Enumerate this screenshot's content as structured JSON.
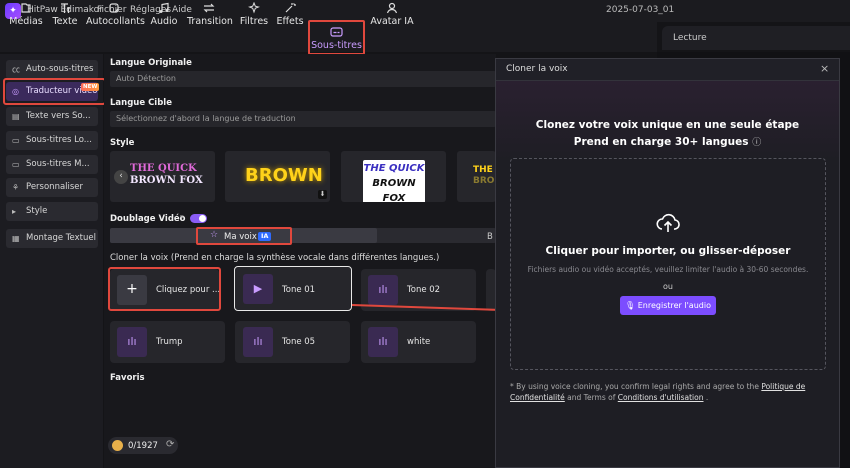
{
  "app": {
    "name": "HitPaw Edimakor",
    "menu": [
      "Fichier",
      "Réglages",
      "Aide"
    ],
    "project_title": "2025-07-03_01"
  },
  "toolbar": {
    "items": [
      {
        "label": "Médias",
        "icon": "media-icon"
      },
      {
        "label": "Texte",
        "icon": "text-icon"
      },
      {
        "label": "Autocollants",
        "icon": "sticker-icon"
      },
      {
        "label": "Audio",
        "icon": "music-icon"
      },
      {
        "label": "Transition",
        "icon": "transition-icon"
      },
      {
        "label": "Filtres",
        "icon": "filter-icon"
      },
      {
        "label": "Effets",
        "icon": "effects-icon"
      },
      {
        "label": "Sous-titres",
        "icon": "subtitles-icon"
      },
      {
        "label": "Avatar IA",
        "icon": "avatar-icon"
      }
    ],
    "active": "Sous-titres"
  },
  "preview": {
    "tab_label": "Lecture"
  },
  "sidebar": {
    "items": [
      {
        "label": "Auto-sous-titres",
        "icon": "cc-icon"
      },
      {
        "label": "Traducteur vidéo",
        "icon": "translate-icon",
        "badge": "NEW"
      },
      {
        "label": "Texte vers So...",
        "icon": "text-to-speech-icon"
      },
      {
        "label": "Sous-titres Lo...",
        "icon": "subtitle-local-icon"
      },
      {
        "label": "Sous-titres M...",
        "icon": "subtitle-multi-icon"
      },
      {
        "label": "Personnaliser",
        "icon": "customize-icon"
      },
      {
        "label": "Style",
        "icon": "caret-right-icon"
      },
      {
        "label": "Montage Textuel",
        "icon": "text-edit-icon"
      }
    ],
    "active": "Traducteur vidéo"
  },
  "main": {
    "langue_originale": {
      "label": "Langue Originale",
      "value": "Auto Détection"
    },
    "langue_cible": {
      "label": "Langue Cible",
      "placeholder": "Sélectionnez d'abord la langue de traduction"
    },
    "style": {
      "label": "Style",
      "cards": [
        {
          "line1": "THE QUICK",
          "line2": "BROWN FOX"
        },
        {
          "line1": "BROWN",
          "line2": ""
        },
        {
          "line1": "THE QUICK",
          "line2": "BROWN FOX"
        },
        {
          "line1": "THE",
          "line2": "BRO"
        }
      ]
    },
    "doublage": {
      "label": "Doublage Vidéo",
      "enabled": true,
      "tab_active": "Ma voix",
      "tab_badge": "IA",
      "tab_other": "B"
    },
    "cloner": {
      "label": "Cloner la voix (Prend en charge la synthèse vocale dans différentes langues.)",
      "add_label": "Cliquez pour ...",
      "voices": [
        "Tone 01",
        "Tone 02",
        "Trump",
        "Tone 05",
        "white"
      ]
    },
    "favoris_label": "Favoris",
    "credits": "0/1927"
  },
  "dialog": {
    "title": "Cloner la voix",
    "heading": "Clonez votre voix unique en une seule étape",
    "subheading": "Prend en charge 30+ langues",
    "upload_title": "Cliquer pour importer, ou glisser-déposer",
    "upload_hint": "Fichiers audio ou vidéo acceptés, veuillez limiter l'audio à 30-60 secondes.",
    "or_label": "ou",
    "record_button": "Enregistrer l'audio",
    "disclaimer_1": "* By using voice cloning, you confirm legal rights and agree to the",
    "disclaimer_link1": "Politique de Confidentialité",
    "disclaimer_and": "and Terms of",
    "disclaimer_link2": "Conditions d'utilisation",
    "disclaimer_end": "."
  },
  "colors": {
    "accent": "#7c4dff",
    "highlight_red": "#e0483d",
    "background": "#18181c"
  }
}
